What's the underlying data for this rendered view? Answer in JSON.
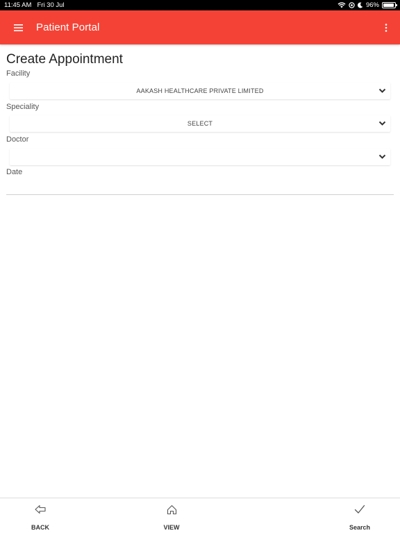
{
  "status_bar": {
    "time": "11:45 AM",
    "date": "Fri 30 Jul",
    "battery": "96%",
    "battery_level": 0.96
  },
  "app_bar": {
    "title": "Patient Portal",
    "menu_icon": "hamburger-menu-icon",
    "more_icon": "more-vertical-icon",
    "color": "#f44336"
  },
  "form": {
    "title": "Create Appointment",
    "facility": {
      "label": "Facility",
      "value": "AAKASH HEALTHCARE PRIVATE LIMITED"
    },
    "speciality": {
      "label": "Speciality",
      "value": "SELECT"
    },
    "doctor": {
      "label": "Doctor",
      "value": ""
    },
    "date": {
      "label": "Date",
      "value": ""
    }
  },
  "bottom_nav": {
    "back": {
      "label": "BACK",
      "icon": "back-arrow-icon"
    },
    "view": {
      "label": "VIEW",
      "icon": "home-icon"
    },
    "search": {
      "label": "Search",
      "icon": "checkmark-icon"
    }
  }
}
